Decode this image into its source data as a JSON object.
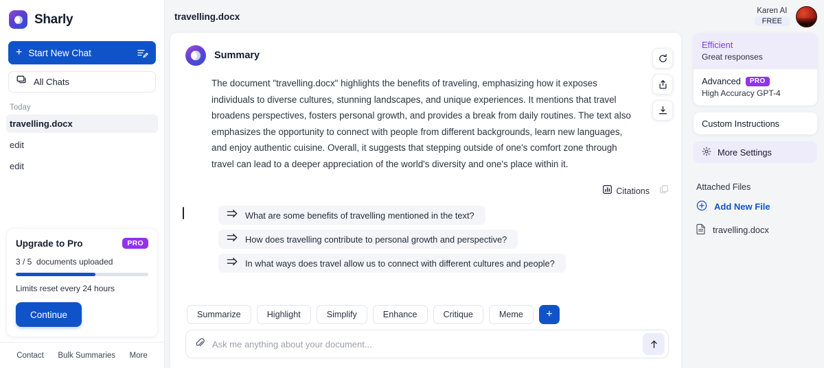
{
  "brand": {
    "name": "Sharly",
    "logo_icon": "sharly-moon-logo"
  },
  "sidebar": {
    "new_chat_label": "Start New Chat",
    "new_chat_plus": "+",
    "compose_icon": "compose-icon",
    "all_chats_label": "All Chats",
    "all_chats_icon": "chats-icon",
    "section_label": "Today",
    "chats": [
      {
        "label": "travelling.docx",
        "active": true
      },
      {
        "label": "edit",
        "active": false
      },
      {
        "label": "edit",
        "active": false
      }
    ],
    "upgrade": {
      "title": "Upgrade to Pro",
      "badge": "PRO",
      "docs_used": "3 / 5",
      "docs_label": "documents uploaded",
      "progress_percent": 60,
      "reset_note": "Limits reset every 24 hours",
      "continue_label": "Continue"
    },
    "footer": [
      {
        "label": "Contact"
      },
      {
        "label": "Bulk Summaries"
      },
      {
        "label": "More"
      }
    ]
  },
  "topbar": {
    "document_title": "travelling.docx"
  },
  "message": {
    "avatar_icon": "assistant-avatar",
    "title": "Summary",
    "body": "The document \"travelling.docx\" highlights the benefits of traveling, emphasizing how it exposes individuals to diverse cultures, stunning landscapes, and unique experiences. It mentions that travel broadens perspectives, fosters personal growth, and provides a break from daily routines. The text also emphasizes the opportunity to connect with people from different backgrounds, learn new languages, and enjoy authentic cuisine. Overall, it suggests that stepping outside of one's comfort zone through travel can lead to a deeper appreciation of the world's diversity and one's place within it."
  },
  "side_actions": [
    {
      "icon": "refresh-icon",
      "name": "regenerate-button"
    },
    {
      "icon": "share-icon",
      "name": "share-button"
    },
    {
      "icon": "download-icon",
      "name": "download-button"
    }
  ],
  "citations": {
    "label": "Citations",
    "icon": "chart-icon",
    "copy_icon": "copy-icon"
  },
  "suggestions": [
    {
      "icon": "send-arrow-icon",
      "label": "What are some benefits of travelling mentioned in the text?"
    },
    {
      "icon": "send-arrow-icon",
      "label": "How does travelling contribute to personal growth and perspective?"
    },
    {
      "icon": "send-arrow-icon",
      "label": "In what ways does travel allow us to connect with different cultures and people?"
    }
  ],
  "quick_actions": [
    {
      "label": "Summarize"
    },
    {
      "label": "Highlight"
    },
    {
      "label": "Simplify"
    },
    {
      "label": "Enhance"
    },
    {
      "label": "Critique"
    },
    {
      "label": "Meme"
    }
  ],
  "quick_actions_add": "+",
  "composer": {
    "attach_icon": "paperclip-icon",
    "placeholder": "Ask me anything about your document...",
    "value": "",
    "send_icon": "arrow-up-icon"
  },
  "user": {
    "name": "Karen AI",
    "plan_badge": "FREE",
    "avatar_icon": "user-avatar"
  },
  "models": [
    {
      "title": "Efficient",
      "subtitle": "Great responses",
      "badge": "",
      "selected": true
    },
    {
      "title": "Advanced",
      "subtitle": "High Accuracy GPT-4",
      "badge": "PRO",
      "selected": false
    }
  ],
  "settings": {
    "custom_instructions": "Custom Instructions",
    "more_settings": "More Settings",
    "gear_icon": "gear-icon"
  },
  "attached": {
    "title": "Attached Files",
    "add_label": "Add New File",
    "add_icon": "plus-circle-icon",
    "files": [
      {
        "name": "travelling.docx",
        "icon": "document-icon"
      }
    ]
  },
  "colors": {
    "primary_blue": "#1053c9",
    "purple": "#9233ea",
    "selected_purple_bg": "#eeebfa",
    "page_bg": "#f4f5f7"
  }
}
